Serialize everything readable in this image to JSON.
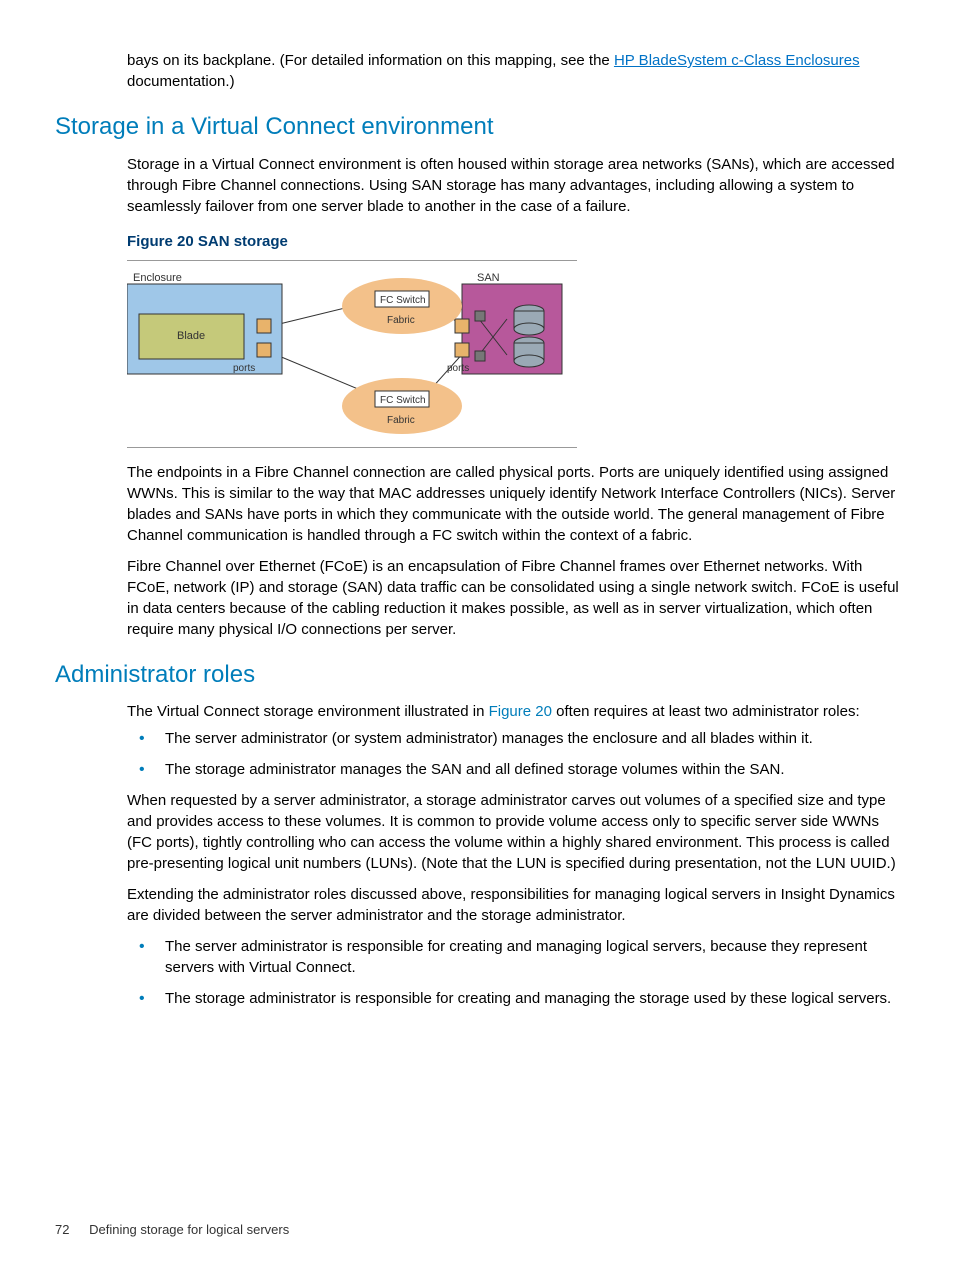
{
  "top_para_pre": "bays on its backplane. (For detailed information on this mapping, see the ",
  "top_link_text": "HP BladeSystem c-Class Enclosures",
  "top_para_post": " documentation.)",
  "heading1": "Storage in a Virtual Connect environment",
  "para1": "Storage in a Virtual Connect environment is often housed within storage area networks (SANs), which are accessed through Fibre Channel connections. Using SAN storage has many advantages, including allowing a system to seamlessly failover from one server blade to another in the case of a failure.",
  "figure_caption": "Figure 20 SAN storage",
  "diagram": {
    "enclosure": "Enclosure",
    "blade": "Blade",
    "san": "SAN",
    "fc_switch": "FC Switch",
    "fabric": "Fabric",
    "ports": "ports"
  },
  "para2": "The endpoints in a Fibre Channel connection are called physical ports. Ports are uniquely identified using assigned WWNs. This is similar to the way that MAC addresses uniquely identify Network Interface Controllers (NICs). Server blades and SANs have ports in which they communicate with the outside world. The general management of Fibre Channel communication is handled through a FC switch within the context of a fabric.",
  "para3": "Fibre Channel over Ethernet (FCoE) is an encapsulation of Fibre Channel frames over Ethernet networks. With FCoE, network (IP) and storage (SAN) data traffic can be consolidated using a single network switch. FCoE is useful in data centers because of the cabling reduction it makes possible, as well as in server virtualization, which often require many physical I/O connections per server.",
  "heading2": "Administrator roles",
  "para4_pre": "The Virtual Connect storage environment illustrated in ",
  "para4_link": "Figure 20",
  "para4_post": " often requires at least two administrator roles:",
  "list1_item1": "The server administrator (or system administrator) manages the enclosure and all blades within it.",
  "list1_item2": "The storage administrator manages the SAN and all defined storage volumes within the SAN.",
  "para5": "When requested by a server administrator, a storage administrator carves out volumes of a specified size and type and provides access to these volumes. It is common to provide volume access only to specific server side WWNs (FC ports), tightly controlling who can access the volume within a highly shared environment. This process is called pre-presenting logical unit numbers (LUNs). (Note that the LUN is specified during presentation, not the LUN UUID.)",
  "para6": "Extending the administrator roles discussed above, responsibilities for managing logical servers in Insight Dynamics are divided between the server administrator and the storage administrator.",
  "list2_item1": "The server administrator is responsible for creating and managing logical servers, because they represent servers with Virtual Connect.",
  "list2_item2": "The storage administrator is responsible for creating and managing the storage used by these logical servers.",
  "footer_page": "72",
  "footer_title": "Defining storage for logical servers"
}
